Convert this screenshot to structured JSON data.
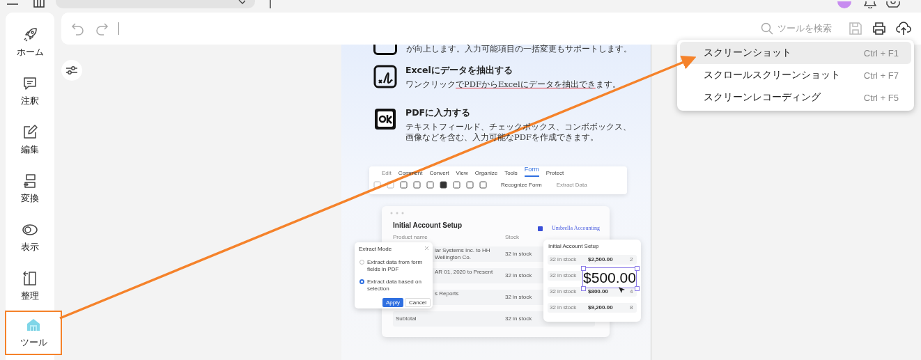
{
  "sidebar": {
    "items": [
      {
        "label": "ホーム",
        "highlighted": false
      },
      {
        "label": "注釈",
        "highlighted": false
      },
      {
        "label": "編集",
        "highlighted": false
      },
      {
        "label": "変換",
        "highlighted": false
      },
      {
        "label": "表示",
        "highlighted": false
      },
      {
        "label": "整理",
        "highlighted": false
      },
      {
        "label": "ツール",
        "highlighted": true
      }
    ]
  },
  "toolbar": {
    "search_placeholder": "ツールを検索",
    "save_disabled": true
  },
  "menu": {
    "items": [
      {
        "label": "スクリーンショット",
        "shortcut": "Ctrl + F1",
        "selected": true
      },
      {
        "label": "スクロールスクリーンショット",
        "shortcut": "Ctrl + F7",
        "selected": false
      },
      {
        "label": "スクリーンレコーディング",
        "shortcut": "Ctrl + F5",
        "selected": false
      }
    ]
  },
  "document": {
    "intro_tail": "が向上します。入力可能項目の一括変更もサポートします。",
    "features": [
      {
        "title": "Excelにデータを抽出する",
        "description": [
          {
            "text": "ワンクリック",
            "underlined": false
          },
          {
            "text": "でPDFからExcelにデータを抽出でき",
            "underlined": true
          },
          {
            "text": "ます。",
            "underlined": false
          }
        ]
      },
      {
        "title": "PDFに入力する",
        "description": [
          {
            "text": "テキストフィールド、チェックボックス、コンボボックス、画像などを含む、入力可能なPDFを作成できます。",
            "underlined": false
          }
        ]
      }
    ],
    "mock": {
      "tabs": [
        {
          "label": "Edit",
          "selected": false,
          "disabled": true
        },
        {
          "label": "Comment",
          "selected": false,
          "disabled": false
        },
        {
          "label": "Convert",
          "selected": false,
          "disabled": false
        },
        {
          "label": "View",
          "selected": false,
          "disabled": false
        },
        {
          "label": "Organize",
          "selected": false,
          "disabled": false
        },
        {
          "label": "Tools",
          "selected": false,
          "disabled": false
        },
        {
          "label": "Form",
          "selected": true,
          "disabled": false
        },
        {
          "label": "Protect",
          "selected": false,
          "disabled": false
        }
      ],
      "actions": [
        {
          "label": "Recognize Form",
          "disabled": false
        },
        {
          "label": "Extract Data",
          "disabled": true
        }
      ],
      "card": {
        "title": "Initial Account Setup",
        "brand": "Umbrella Accounting",
        "columns": [
          "Product name",
          "Stock"
        ],
        "rows": [
          [
            "lar Systems Inc. to HH Wellington Co.",
            "32 in stock"
          ],
          [
            "AR 01, 2020 to Present",
            "32 in stock"
          ],
          [
            "s Reports",
            "32 in stock"
          ],
          [
            "Subtotal",
            "32 in stock"
          ]
        ]
      },
      "dialog": {
        "title": "Extract Mode",
        "options": [
          {
            "label": "Extract data from form fields in PDF",
            "selected": false
          },
          {
            "label": "Extract data based on selection",
            "selected": true
          }
        ],
        "buttons": [
          "Apply",
          "Cancel"
        ]
      },
      "side_card": {
        "title": "Initial Account Setup",
        "rows": [
          [
            "32 in stock",
            "$2,500.00",
            "2"
          ],
          [
            "32 in stock",
            "",
            ""
          ],
          [
            "32 in stock",
            "$800.00",
            "4"
          ],
          [
            "32 in stock",
            "$9,200.00",
            "8"
          ]
        ],
        "selection": "$500.00"
      }
    }
  }
}
